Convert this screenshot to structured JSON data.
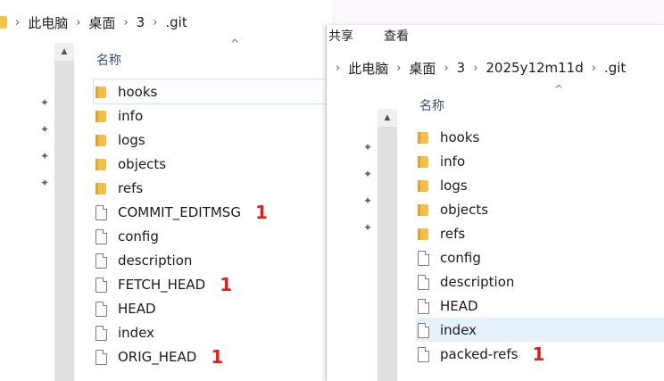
{
  "left_window": {
    "breadcrumb": [
      "此电脑",
      "桌面",
      "3",
      ".git"
    ],
    "column_header": "名称",
    "files": [
      {
        "name": "hooks",
        "type": "folder",
        "mark": ""
      },
      {
        "name": "info",
        "type": "folder",
        "mark": ""
      },
      {
        "name": "logs",
        "type": "folder",
        "mark": ""
      },
      {
        "name": "objects",
        "type": "folder",
        "mark": ""
      },
      {
        "name": "refs",
        "type": "folder",
        "mark": ""
      },
      {
        "name": "COMMIT_EDITMSG",
        "type": "file",
        "mark": "1"
      },
      {
        "name": "config",
        "type": "file",
        "mark": ""
      },
      {
        "name": "description",
        "type": "file",
        "mark": ""
      },
      {
        "name": "FETCH_HEAD",
        "type": "file",
        "mark": "1"
      },
      {
        "name": "HEAD",
        "type": "file",
        "mark": ""
      },
      {
        "name": "index",
        "type": "file",
        "mark": ""
      },
      {
        "name": "ORIG_HEAD",
        "type": "file",
        "mark": "1"
      }
    ]
  },
  "right_window": {
    "menu": [
      "共享",
      "查看"
    ],
    "breadcrumb": [
      "此电脑",
      "桌面",
      "3",
      "2025y12m11d",
      ".git"
    ],
    "column_header": "名称",
    "files": [
      {
        "name": "hooks",
        "type": "folder",
        "mark": ""
      },
      {
        "name": "info",
        "type": "folder",
        "mark": ""
      },
      {
        "name": "logs",
        "type": "folder",
        "mark": ""
      },
      {
        "name": "objects",
        "type": "folder",
        "mark": ""
      },
      {
        "name": "refs",
        "type": "folder",
        "mark": ""
      },
      {
        "name": "config",
        "type": "file",
        "mark": ""
      },
      {
        "name": "description",
        "type": "file",
        "mark": ""
      },
      {
        "name": "HEAD",
        "type": "file",
        "mark": ""
      },
      {
        "name": "index",
        "type": "file",
        "mark": "",
        "selected": true
      },
      {
        "name": "packed-refs",
        "type": "file",
        "mark": "1"
      }
    ]
  },
  "icons": {
    "folder": "folder-icon",
    "file": "file-icon",
    "pin": "pin-icon",
    "chevron": "chevron-right-icon",
    "sort": "sort-up-icon"
  }
}
